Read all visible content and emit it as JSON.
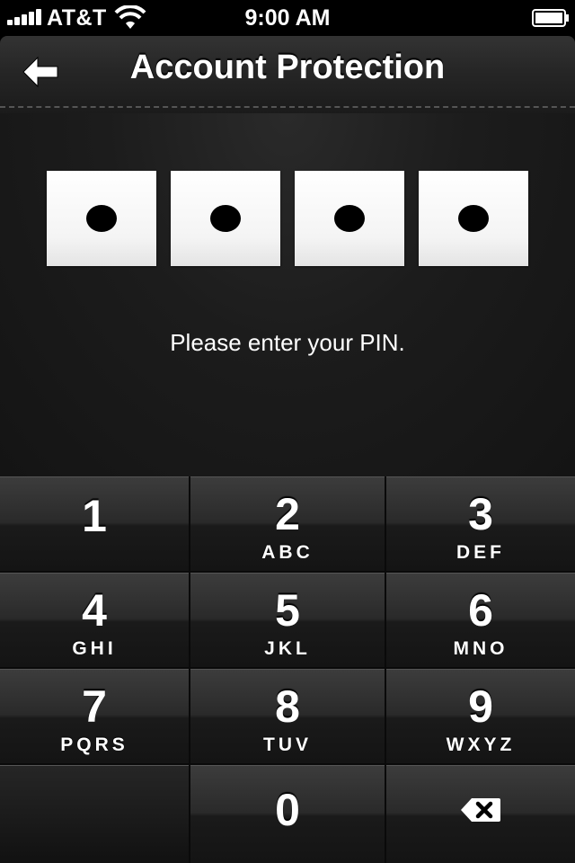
{
  "status_bar": {
    "carrier": "AT&T",
    "time": "9:00 AM",
    "signal_icon": "signal-bars-icon",
    "wifi_icon": "wifi-icon",
    "battery_icon": "battery-icon"
  },
  "nav": {
    "title": "Account Protection",
    "back_icon": "arrow-left-icon"
  },
  "pin": {
    "digits_entered": 4,
    "digits_total": 4,
    "prompt": "Please enter your PIN."
  },
  "keypad": {
    "keys": [
      {
        "number": "1",
        "letters": ""
      },
      {
        "number": "2",
        "letters": "ABC"
      },
      {
        "number": "3",
        "letters": "DEF"
      },
      {
        "number": "4",
        "letters": "GHI"
      },
      {
        "number": "5",
        "letters": "JKL"
      },
      {
        "number": "6",
        "letters": "MNO"
      },
      {
        "number": "7",
        "letters": "PQRS"
      },
      {
        "number": "8",
        "letters": "TUV"
      },
      {
        "number": "9",
        "letters": "WXYZ"
      },
      {
        "number": "0",
        "letters": ""
      }
    ],
    "delete_icon": "backspace-icon"
  }
}
